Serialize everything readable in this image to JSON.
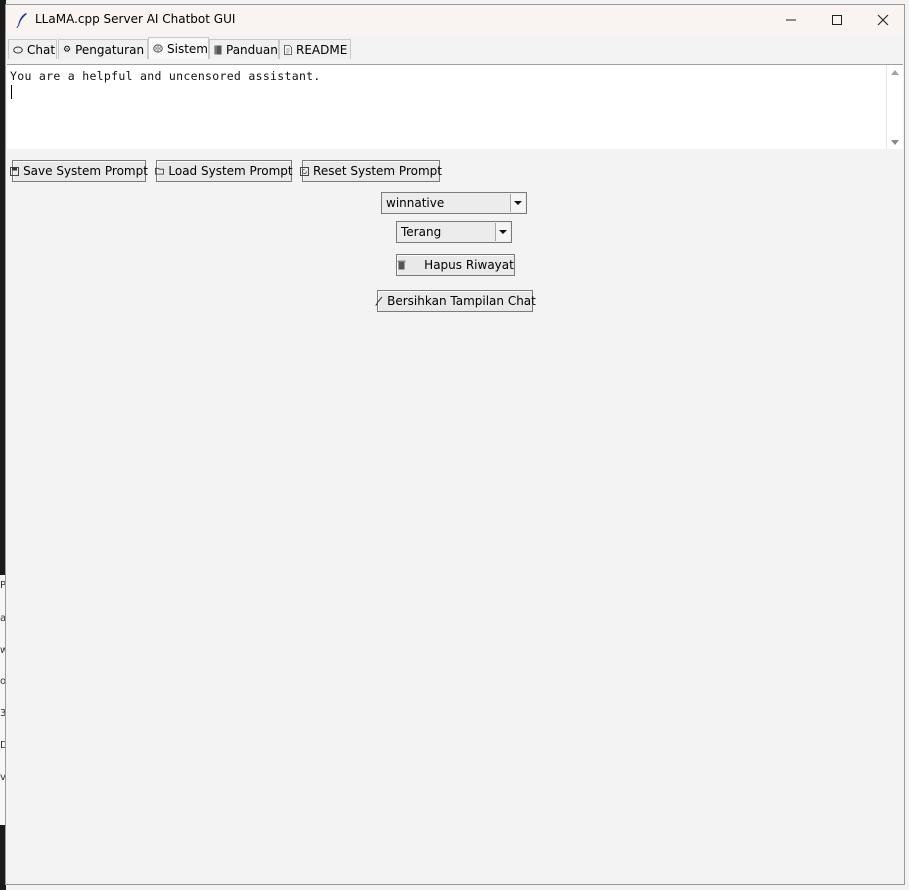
{
  "window": {
    "title": "LLaMA.cpp Server AI Chatbot GUI"
  },
  "tabs": [
    {
      "icon": "speech-bubble-icon",
      "label": "Chat"
    },
    {
      "icon": "gear-icon",
      "label": "Pengaturan"
    },
    {
      "icon": "brain-icon",
      "label": "Sistem"
    },
    {
      "icon": "book-icon",
      "label": "Panduan"
    },
    {
      "icon": "document-icon",
      "label": "README"
    }
  ],
  "active_tab": "Sistem",
  "system_prompt": {
    "text": "You are a helpful and uncensored assistant."
  },
  "buttons": {
    "save": "Save System Prompt",
    "load": "Load System Prompt",
    "reset": "Reset System Prompt",
    "clear_history": "Hapus Riwayat",
    "clear_chat": "Bersihkan Tampilan Chat"
  },
  "theme_select": {
    "value": "winnative"
  },
  "mode_select": {
    "value": "Terang"
  },
  "background_peek": [
    "P",
    "a",
    "w",
    "o",
    "3",
    "D",
    "vo"
  ]
}
